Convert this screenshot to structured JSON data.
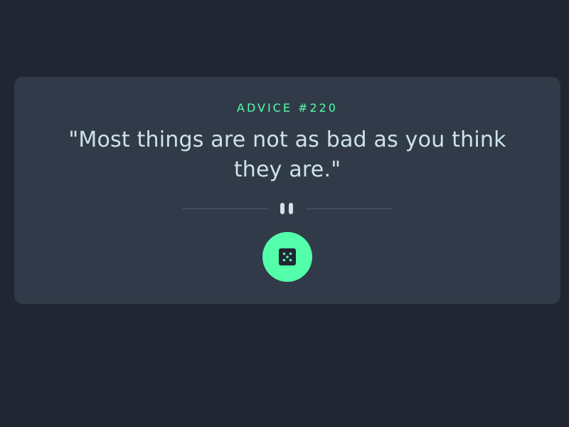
{
  "advice": {
    "id_label": "ADVICE #220",
    "quote": "\"Most things are not as bad as you think they are.\""
  },
  "icons": {
    "divider": "pause-icon",
    "button": "dice-icon"
  },
  "colors": {
    "background": "#202632",
    "card": "#313a48",
    "accent": "#53ffaa",
    "text": "#cee3e9",
    "divider": "#4f5d74"
  }
}
